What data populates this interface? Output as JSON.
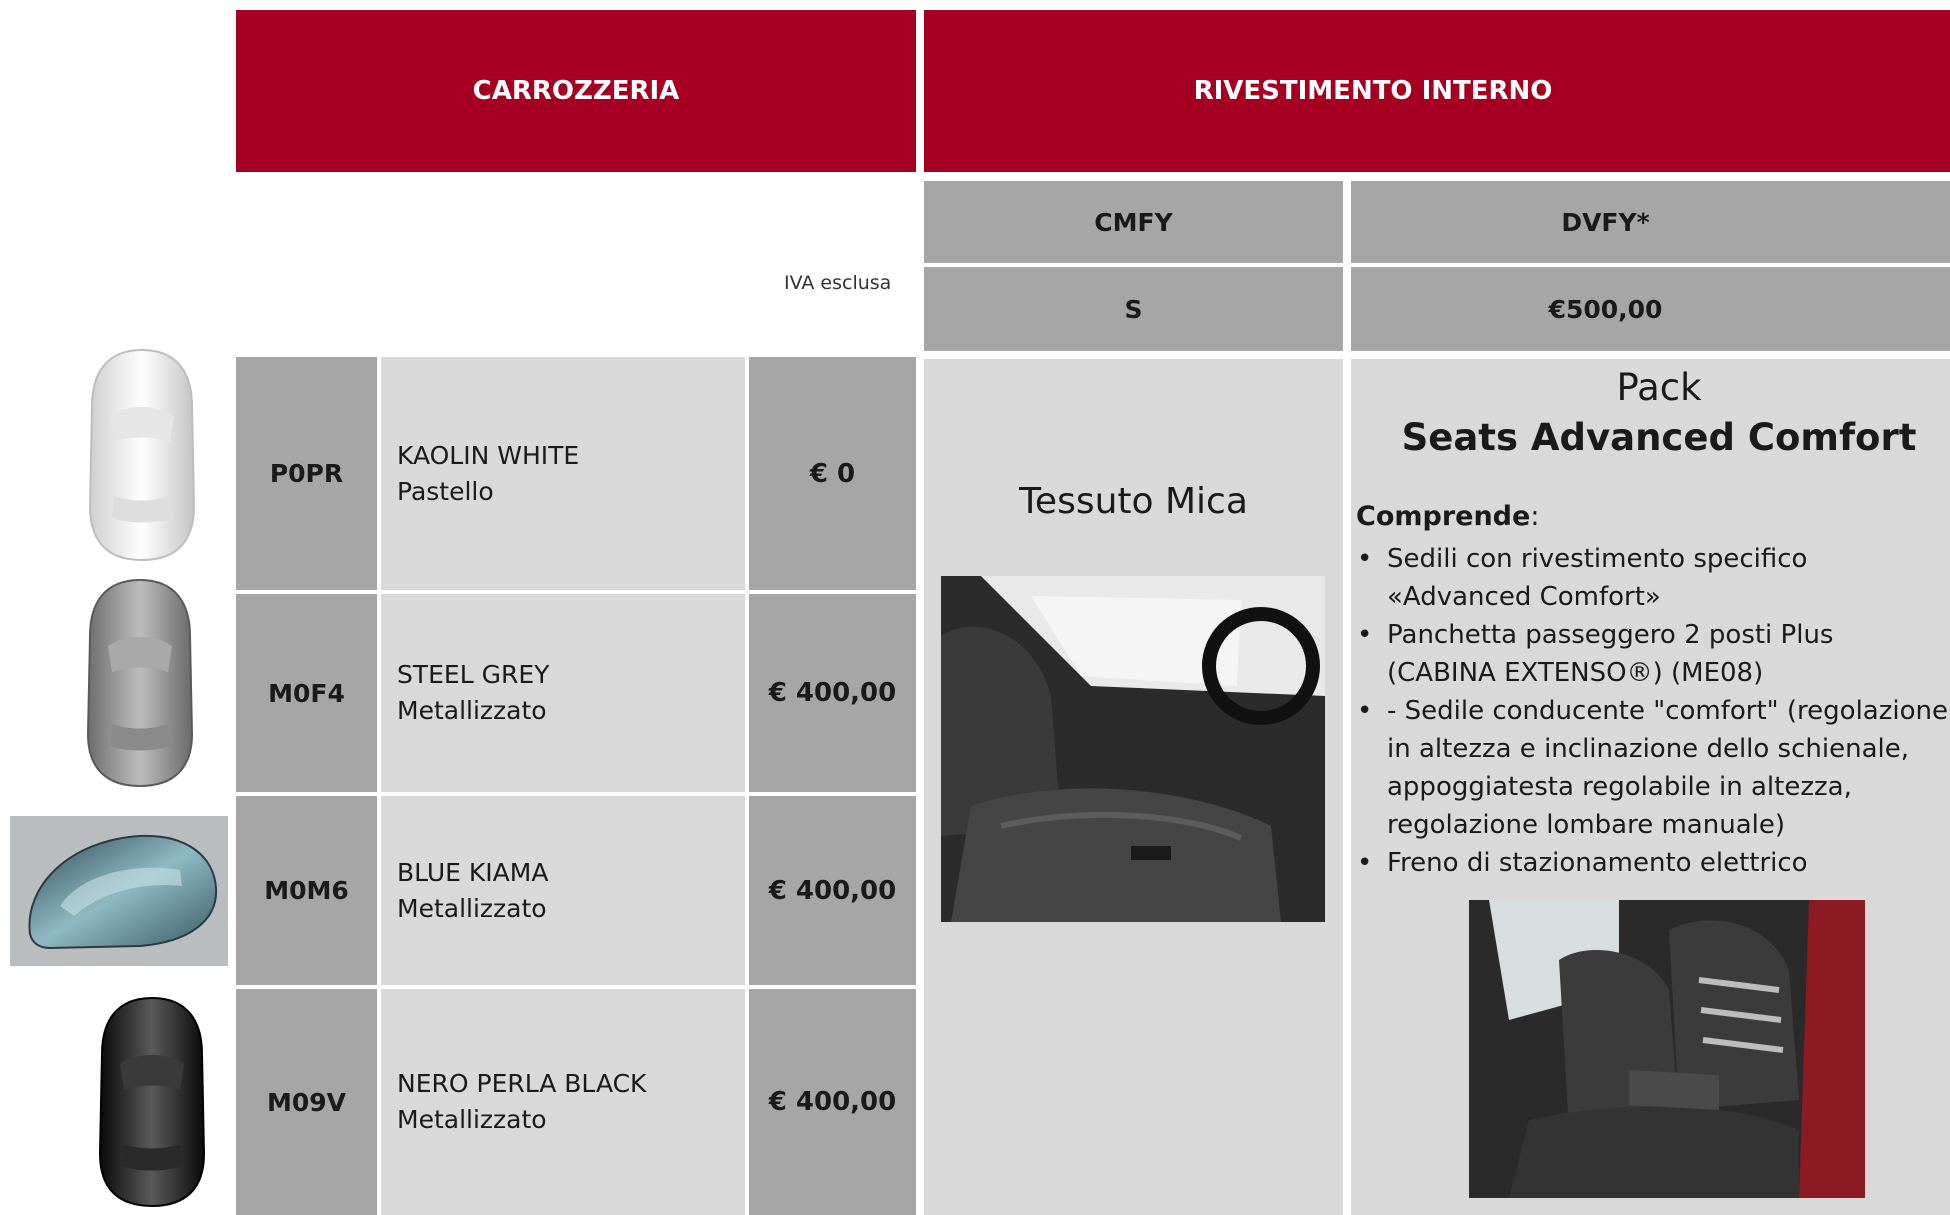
{
  "headers": {
    "body": "CARROZZERIA",
    "interior": "RIVESTIMENTO INTERNO"
  },
  "vat_note": "IVA esclusa",
  "interior_options": [
    {
      "code": "CMFY",
      "price": "S"
    },
    {
      "code": "DVFY*",
      "price": "€500,00"
    }
  ],
  "colors": [
    {
      "code": "P0PR",
      "name": "KAOLIN WHITE",
      "type": "Pastello",
      "price": "€ 0",
      "swatch": "#f2f2f2"
    },
    {
      "code": "M0F4",
      "name": "STEEL GREY",
      "type": "Metallizzato",
      "price": "€ 400,00",
      "swatch": "#9c9c9c"
    },
    {
      "code": "M0M6",
      "name": "BLUE KIAMA",
      "type": "Metallizzato",
      "price": "€ 400,00",
      "swatch": "#7fa7b0"
    },
    {
      "code": "M09V",
      "name": "NERO PERLA BLACK",
      "type": "Metallizzato",
      "price": "€ 400,00",
      "swatch": "#1c1c1c"
    }
  ],
  "fabric": {
    "title": "Tessuto Mica",
    "image_icon": "seat-photo-icon"
  },
  "pack": {
    "line1": "Pack",
    "line2": "Seats Advanced Comfort",
    "includes_label": "Comprende",
    "includes_colon": ":",
    "bullet": "•",
    "items": [
      "Sedili con rivestimento specifico «Advanced Comfort»",
      "Panchetta passeggero 2 posti Plus (CABINA EXTENSO®) (ME08)",
      "- Sedile conducente \"comfort\" (regolazione in altezza e inclinazione dello schienale, appoggiatesta regolabile in altezza, regolazione lombare manuale)",
      "Freno di stazionamento elettrico"
    ],
    "image_icon": "comfort-seat-photo-icon"
  },
  "accent_color": "#a50021"
}
